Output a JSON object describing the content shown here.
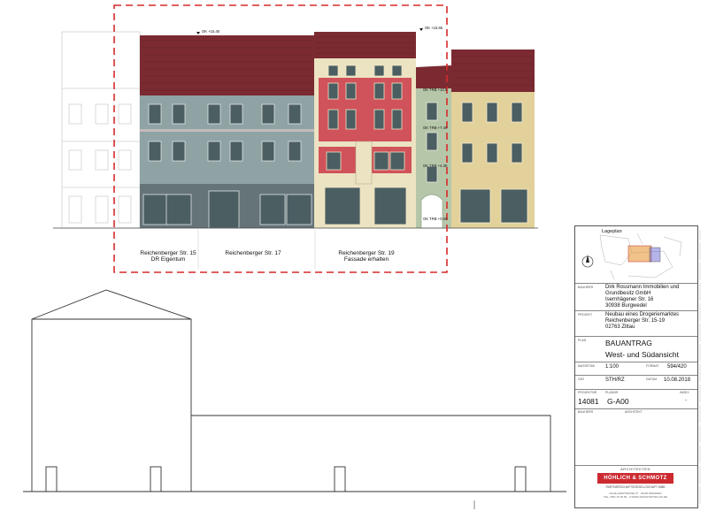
{
  "elevation": {
    "levels": {
      "main_ridge": "OK +15.40",
      "top_ridge": "OK +15.65",
      "oktr_1": "OK TRB +10.5",
      "oktr_2": "OK TRB +7.40",
      "oktr_3": "OK TRB +4.30",
      "oktr_ground": "OK TRB +0.00"
    },
    "labels": {
      "b15_line1": "Reichenberger Str. 15",
      "b15_line2": "DR Eigentum",
      "b17": "Reichenberger Str. 17",
      "b19_line1": "Reichenberger Str. 19",
      "b19_line2": "Fassade erhalten"
    }
  },
  "titleblock": {
    "lageplan_title": "Lageplan",
    "bauherr_key": "Bauherr",
    "bauherr": [
      "Dirk Rossmann Immobilien und",
      "Grundbesitz GmbH",
      "Isernhägener Str. 16",
      "30938 Burgwedel"
    ],
    "projekt_key": "Projekt",
    "projekt": [
      "Neubau eines Drogeriemarktes",
      "Reichenberger Str. 15-19",
      "02763 Zittau"
    ],
    "plan_key": "Plan",
    "plan_type": "BAUANTRAG",
    "plan_title": "West- und Südansicht",
    "massstab_key": "Maßstab",
    "massstab": "1:100",
    "format_key": "Format",
    "format": "594/420",
    "gez_key": "Gez",
    "gez": "STH/RZ",
    "datum_key": "Datum",
    "datum": "10.08.2018",
    "index_key": "Index",
    "index": "-",
    "projektnr_key": "Projektnr",
    "projektnr": "14081",
    "plannr_key": "Plannr",
    "plannr": "G-A00",
    "bauherr2_key": "Bauherr",
    "architekt_key": "Architekt",
    "architekten_heading": "ARCHITEKTEN",
    "firm": "HÖHLICH & SCHMOTZ",
    "firm_sub": "PARTNERSCHAFTSGESELLSCHAFT MBB",
    "firm_addr1": "SCHILLERSTRASSE  27 · 01326 DRESDEN",
    "firm_addr2": "TEL. 0351 26 90 80 - 0   WWW.ARCHITEKTEN-HS.DE"
  },
  "colors": {
    "roof": "#7b2a31",
    "facade_blue": "#8fa3a5",
    "facade_red": "#d0525a",
    "facade_cream": "#ece3c2",
    "facade_green": "#b6c6a9",
    "facade_yellow": "#e2d19a",
    "ground_dark": "#657479",
    "window": "#4b5e62",
    "boundary": "#d62a2a",
    "firm_red": "#cc2a30"
  }
}
